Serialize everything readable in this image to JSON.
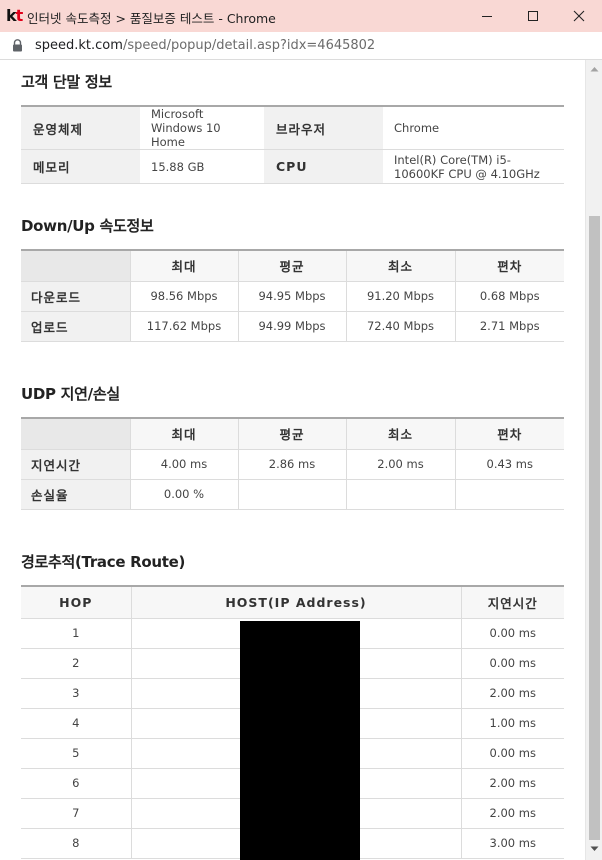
{
  "window": {
    "title": "인터넷 속도측정 > 품질보증 테스트 - Chrome",
    "url_host": "speed.kt.com",
    "url_path": "/speed/popup/detail.asp?idx=4645802"
  },
  "logo": {
    "k": "k",
    "t": "t"
  },
  "customer": {
    "title": "고객 단말 정보",
    "rows": [
      {
        "label1": "운영체제",
        "value1": "Microsoft Windows 10 Home",
        "label2": "브라우저",
        "value2": "Chrome"
      },
      {
        "label1": "메모리",
        "value1": "15.88 GB",
        "label2": "CPU",
        "value2": "Intel(R) Core(TM) i5-10600KF CPU @ 4.10GHz"
      }
    ]
  },
  "speed": {
    "title": "Down/Up 속도정보",
    "headers": [
      "최대",
      "평균",
      "최소",
      "편차"
    ],
    "rows": [
      {
        "label": "다운로드",
        "cells": [
          "98.56 Mbps",
          "94.95 Mbps",
          "91.20 Mbps",
          "0.68 Mbps"
        ]
      },
      {
        "label": "업로드",
        "cells": [
          "117.62 Mbps",
          "94.99 Mbps",
          "72.40 Mbps",
          "2.71 Mbps"
        ]
      }
    ]
  },
  "udp": {
    "title": "UDP 지연/손실",
    "headers": [
      "최대",
      "평균",
      "최소",
      "편차"
    ],
    "rows": [
      {
        "label": "지연시간",
        "cells": [
          "4.00 ms",
          "2.86 ms",
          "2.00 ms",
          "0.43 ms"
        ]
      },
      {
        "label": "손실율",
        "cells": [
          "0.00 %",
          "",
          "",
          ""
        ]
      }
    ]
  },
  "trace": {
    "title": "경로추적(Trace Route)",
    "headers": [
      "HOP",
      "HOST(IP Address)",
      "지연시간"
    ],
    "rows": [
      {
        "hop": "1",
        "latency": "0.00 ms"
      },
      {
        "hop": "2",
        "latency": "0.00 ms"
      },
      {
        "hop": "3",
        "latency": "2.00 ms"
      },
      {
        "hop": "4",
        "latency": "1.00 ms"
      },
      {
        "hop": "5",
        "latency": "0.00 ms"
      },
      {
        "hop": "6",
        "latency": "2.00 ms"
      },
      {
        "hop": "7",
        "latency": "2.00 ms"
      },
      {
        "hop": "8",
        "latency": "3.00 ms"
      }
    ]
  },
  "colors": {
    "titlebar": "#f9d8d4",
    "logo_red": "#e2001a"
  }
}
